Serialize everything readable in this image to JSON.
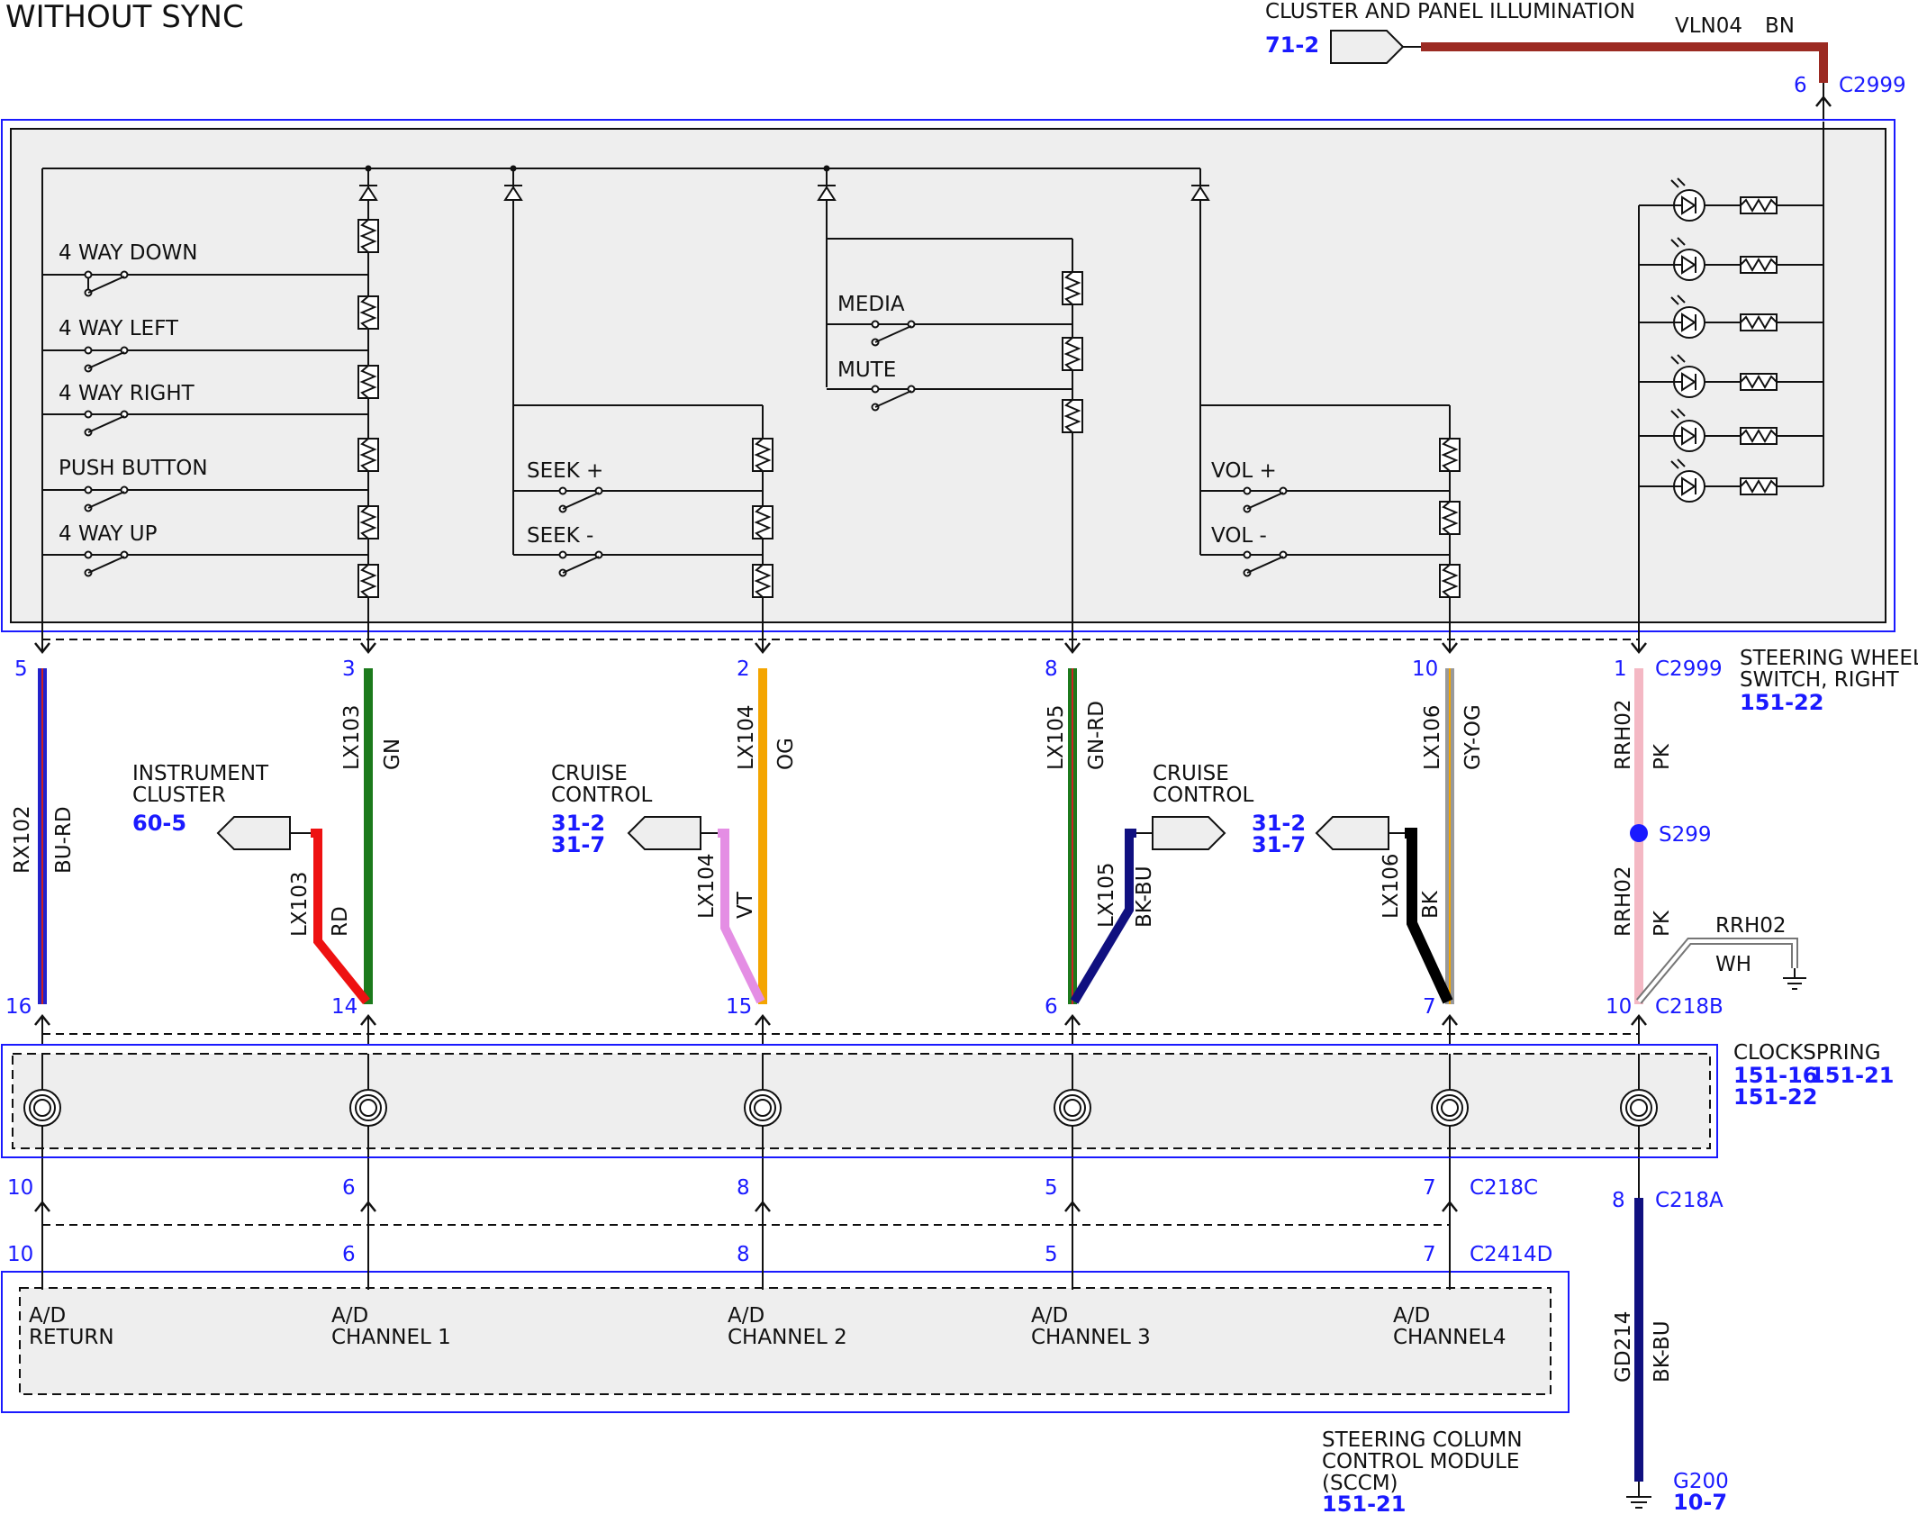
{
  "title": "WITHOUT SYNC",
  "illumination": {
    "label": "CLUSTER AND PANEL ILLUMINATION",
    "ref": "71-2",
    "circuit": "VLN04",
    "color": "BN",
    "pin": "6",
    "connector": "C2999"
  },
  "switch": {
    "name_line1": "STEERING WHEEL",
    "name_line2": "SWITCH, RIGHT",
    "ref": "151-22",
    "switches_left": [
      "4 WAY DOWN",
      "4 WAY LEFT",
      "4 WAY RIGHT",
      "PUSH BUTTON",
      "4 WAY UP"
    ],
    "switches_seek": [
      "SEEK +",
      "SEEK -"
    ],
    "switches_media": [
      "MEDIA",
      "MUTE"
    ],
    "switches_vol": [
      "VOL +",
      "VOL -"
    ]
  },
  "wires": [
    {
      "top_pin": "5",
      "bottom_pin": "16",
      "circuit": "RX102",
      "color_code": "BU-RD"
    },
    {
      "top_pin": "3",
      "bottom_pin": "14",
      "circuit": "LX103",
      "color_code": "GN"
    },
    {
      "top_pin": "2",
      "bottom_pin": "15",
      "circuit": "LX104",
      "color_code": "OG"
    },
    {
      "top_pin": "8",
      "bottom_pin": "6",
      "circuit": "LX105",
      "color_code": "GN-RD"
    },
    {
      "top_pin": "10",
      "bottom_pin": "7",
      "circuit": "LX106",
      "color_code": "GY-OG"
    },
    {
      "top_pin": "1",
      "bottom_pin": "10",
      "circuit": "RRH02",
      "color_code": "PK"
    }
  ],
  "connectors": {
    "top": "C2999",
    "bottom": "C218B",
    "c218c": "C218C",
    "c2414d": "C2414D",
    "c218a": "C218A"
  },
  "branches": {
    "instrument": {
      "label1": "INSTRUMENT",
      "label2": "CLUSTER",
      "ref": "60-5",
      "circuit": "LX103",
      "color": "RD"
    },
    "cruise1": {
      "label1": "CRUISE",
      "label2": "CONTROL",
      "ref1": "31-2",
      "ref2": "31-7",
      "circuit": "LX104",
      "color": "VT"
    },
    "cruise2": {
      "label1": "CRUISE",
      "label2": "CONTROL",
      "ref1": "31-2",
      "ref2": "31-7",
      "circuit": "LX105",
      "color": "BK-BU"
    },
    "lx106": {
      "circuit": "LX106",
      "color": "BK"
    },
    "splice": "S299",
    "rrh02_lower": {
      "circuit": "RRH02",
      "color": "PK"
    },
    "shield": {
      "circuit": "RRH02",
      "color": "WH"
    }
  },
  "clockspring": {
    "label": "CLOCKSPRING",
    "ref1": "151-16",
    "ref2": "151-21",
    "ref3": "151-22"
  },
  "c218c_pins": [
    "10",
    "6",
    "8",
    "5",
    "7"
  ],
  "c2414d_pins": [
    "10",
    "6",
    "8",
    "5",
    "7"
  ],
  "sccm": {
    "channels": [
      {
        "l1": "A/D",
        "l2": "RETURN"
      },
      {
        "l1": "A/D",
        "l2": "CHANNEL 1"
      },
      {
        "l1": "A/D",
        "l2": "CHANNEL 2"
      },
      {
        "l1": "A/D",
        "l2": "CHANNEL 3"
      },
      {
        "l1": "A/D",
        "l2": "CHANNEL4"
      }
    ],
    "name1": "STEERING COLUMN",
    "name2": "CONTROL MODULE",
    "name3": "(SCCM)",
    "ref": "151-21"
  },
  "ground": {
    "pin": "8",
    "circuit": "GD214",
    "color": "BK-BU",
    "name": "G200",
    "ref": "10-7"
  },
  "colors": {
    "blue": "#1a1aff",
    "bn": "#9b2a22",
    "gn": "#1c7a1c",
    "og": "#f4a500",
    "pk": "#f4b8c4",
    "rd": "#ee1111",
    "vt": "#e48ee4",
    "bkbu": "#101080"
  }
}
